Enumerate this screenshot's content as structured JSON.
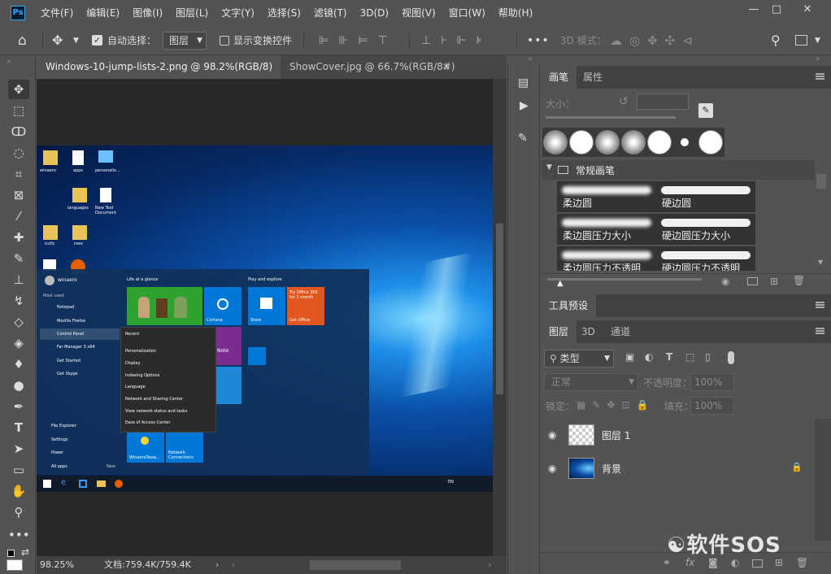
{
  "app": {
    "logo": "Ps"
  },
  "menu": [
    "文件(F)",
    "编辑(E)",
    "图像(I)",
    "图层(L)",
    "文字(Y)",
    "选择(S)",
    "滤镜(T)",
    "3D(D)",
    "视图(V)",
    "窗口(W)",
    "帮助(H)"
  ],
  "window_controls": {
    "minimize": "—",
    "maximize": "□",
    "close": "✕"
  },
  "options": {
    "auto_select_label": "自动选择：",
    "auto_select_target": "图层",
    "show_transform_label": "显示变换控件",
    "mode_3d_label": "3D 模式："
  },
  "doc_tabs": [
    {
      "title": "Windows-10-jump-lists-2.png @ 98.2%(RGB/8) *",
      "active": true
    },
    {
      "title": "ShowCover.jpg @ 66.7%(RGB/8#)",
      "active": false
    }
  ],
  "status": {
    "zoom": "98.25%",
    "doc_info": "文档:759.4K/759.4K"
  },
  "brush_panel": {
    "tabs": [
      "画笔",
      "属性"
    ],
    "size_label": "大小：",
    "folder_name": "常规画笔",
    "brushes": [
      "柔边圆",
      "硬边圆",
      "柔边圆压力大小",
      "硬边圆压力大小",
      "柔边圆压力不透明",
      "硬边圆压力不透明"
    ]
  },
  "tool_presets": {
    "title": "工具预设"
  },
  "layers_panel": {
    "tabs": [
      "图层",
      "3D",
      "通道"
    ],
    "filter_kind": "类型",
    "blend_mode": "正常",
    "opacity_label": "不透明度：",
    "opacity_value": "100%",
    "lock_label": "锁定：",
    "fill_label": "填充：",
    "fill_value": "100%",
    "layers": [
      {
        "name": "图层 1"
      },
      {
        "name": "背景"
      }
    ]
  },
  "screenshot_content": {
    "desktop_icons": [
      "winaero",
      "apps",
      "personaliz...",
      "languages",
      "New Text Document",
      "icofx",
      "roex"
    ],
    "start_user": "winaero",
    "most_used_label": "Most used",
    "start_items": [
      "Notepad",
      "Mozilla Firefox",
      "Control Panel",
      "Far Manager 3 x64",
      "Get Started",
      "Get Skype"
    ],
    "start_bottom": [
      "File Explorer",
      "Settings",
      "Power",
      "All apps"
    ],
    "new_label": "New",
    "life_label": "Life at a glance",
    "play_label": "Play and explore",
    "tiles": [
      "Cortana",
      "Store",
      "Try Office 365 for 1 month",
      "Get Office",
      "Note",
      "WinaeroTwea...",
      "Network Connections"
    ],
    "recent_title": "Recent",
    "recent_items": [
      "Personalization",
      "Display",
      "Indexing Options",
      "Language",
      "Network and Sharing Center",
      "View network status and tasks",
      "Ease of Access Center"
    ],
    "taskbar_lang": "EN"
  },
  "watermark": {
    "text": "软件SOS"
  },
  "colors": {
    "accent": "#31a8ff",
    "ui_bg": "#535353",
    "win_blue": "#0d63b8",
    "tile_green": "#2ea12e",
    "tile_orange": "#e2571f",
    "tile_purple": "#7a2d8f"
  }
}
